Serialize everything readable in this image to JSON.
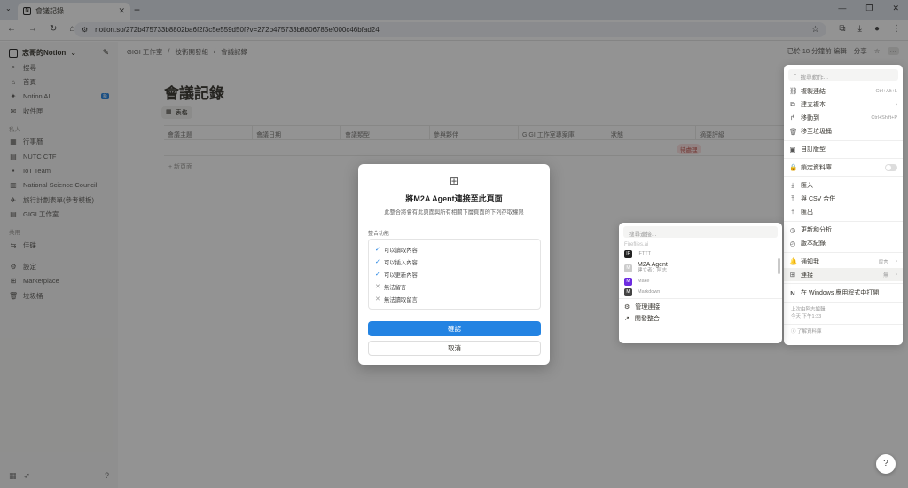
{
  "browser": {
    "tab_title": "會議記錄",
    "url": "notion.so/272b475733b8802ba6f2f3c5e559d50f?v=272b475733b8806785ef000c46bfad24"
  },
  "sidebar": {
    "workspace": "志哥的Notion",
    "top_items": [
      {
        "icon": "⌕",
        "label": "搜尋"
      },
      {
        "icon": "⌂",
        "label": "首頁"
      },
      {
        "icon": "✦",
        "label": "Notion AI",
        "badge": "新"
      },
      {
        "icon": "✉",
        "label": "收件匣"
      }
    ],
    "section_private": "私人",
    "private_items": [
      {
        "icon": "▦",
        "label": "行事曆"
      },
      {
        "icon": "▤",
        "label": "NUTC CTF"
      },
      {
        "icon": "▪",
        "label": "IoT Team"
      },
      {
        "icon": "▥",
        "label": "National Science Council"
      },
      {
        "icon": "✈",
        "label": "旅行計劃表單(參考模板)"
      },
      {
        "icon": "▤",
        "label": "GIGI 工作室"
      }
    ],
    "section_shared": "共用",
    "shared_items": [
      {
        "icon": "⇆",
        "label": "佳碟"
      }
    ],
    "bottom_items": [
      {
        "icon": "⚙",
        "label": "設定"
      },
      {
        "icon": "⊞",
        "label": "Marketplace"
      },
      {
        "icon": "🗑",
        "label": "垃圾桶"
      }
    ]
  },
  "page": {
    "breadcrumb": [
      "GIGI 工作室",
      "技術開發組",
      "會議記錄"
    ],
    "edited": "已於 18 分鐘前 編輯",
    "share": "分享",
    "title": "會議記錄",
    "view_tab": "表格",
    "columns": [
      "會議主題",
      "會議日期",
      "會議類型",
      "參與夥伴",
      "GIGI 工作室專案庫",
      "狀態",
      "摘要評級"
    ],
    "status_value": "待處理",
    "new_row": "+ 新頁面"
  },
  "dialog": {
    "title": "將M2A Agent連接至此頁面",
    "subtitle": "此整合將會有此頁面與所有相關下層頁面的下列存取權限",
    "cap_label": "整合功能",
    "capabilities": [
      {
        "mark": "✓",
        "text": "可以讀取內容"
      },
      {
        "mark": "✓",
        "text": "可以插入內容"
      },
      {
        "mark": "✓",
        "text": "可以更新內容"
      },
      {
        "mark": "✕",
        "text": "無法留言"
      },
      {
        "mark": "✕",
        "text": "無法讀取留言"
      }
    ],
    "confirm": "確認",
    "cancel": "取消"
  },
  "menu": {
    "search_placeholder": "搜尋動作...",
    "items": [
      {
        "icon": "⛓",
        "label": "複製連結",
        "shortcut": "Ctrl+Alt+L"
      },
      {
        "icon": "⧉",
        "label": "建立複本",
        "shortcut": "›"
      },
      {
        "icon": "↱",
        "label": "移動到",
        "shortcut": "Ctrl+Shift+P"
      },
      {
        "icon": "🗑",
        "label": "移至垃圾桶",
        "shortcut": ""
      }
    ],
    "items2": [
      {
        "icon": "▣",
        "label": "自訂版型"
      }
    ],
    "lock_label": "鎖定資料庫",
    "items3": [
      {
        "icon": "⤓",
        "label": "匯入"
      },
      {
        "icon": "⤒",
        "label": "與 CSV 合併"
      },
      {
        "icon": "⤒",
        "label": "匯出"
      }
    ],
    "items4": [
      {
        "icon": "◷",
        "label": "更新和分析"
      },
      {
        "icon": "◴",
        "label": "版本紀錄"
      }
    ],
    "notify": {
      "icon": "🔔",
      "label": "通知我",
      "value": "留言"
    },
    "connect": {
      "icon": "⊞",
      "label": "連接",
      "value": "無"
    },
    "open_app": {
      "icon": "N",
      "label": "在 Windows 應用程式中打開"
    },
    "footer": [
      "上次由阿志編輯",
      "今天 下午1:33"
    ],
    "learn": "了解資料庫"
  },
  "submenu": {
    "search_placeholder": "搜尋連接...",
    "scrolled_item": "Fireflies.ai",
    "items": [
      {
        "logo": "IF",
        "color": "#222",
        "label": "IFTTT",
        "sub": ""
      },
      {
        "logo": "M",
        "color": "#ccc",
        "label": "M2A Agent",
        "sub": "建立者：阿志"
      },
      {
        "logo": "M",
        "color": "#6d2ce0",
        "label": "Make",
        "sub": ""
      },
      {
        "logo": "M",
        "color": "#444",
        "label": "Markdown",
        "sub": ""
      }
    ],
    "manage": "管理連接",
    "develop": "開發整合"
  }
}
